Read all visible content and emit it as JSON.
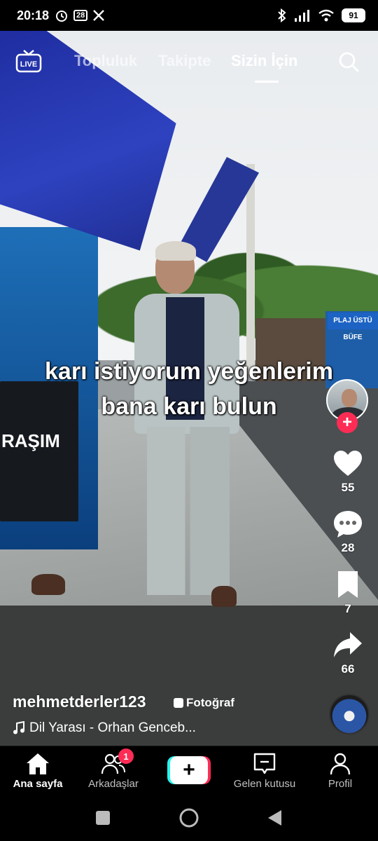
{
  "status_bar": {
    "time": "20:18",
    "calendar_day": "28",
    "battery": "91"
  },
  "top_nav": {
    "live_label": "LIVE",
    "tabs": [
      {
        "label": "Topluluk"
      },
      {
        "label": "Takipte"
      },
      {
        "label": "Sizin İçin"
      }
    ]
  },
  "video": {
    "caption_line1": "karı istiyorum yeğenlerim",
    "caption_line2": "bana karı bulun",
    "freezer_text": "RAŞIM",
    "kiosk_sign": "PLAJ ÜSTÜ BÜFE"
  },
  "rail": {
    "follow_label": "+",
    "likes": "55",
    "comments": "28",
    "saves": "7",
    "shares": "66"
  },
  "post": {
    "username": "mehmetderler123",
    "badge": "Fotoğraf",
    "music": "Dil Yarası - Orhan Genceb..."
  },
  "bottom_nav": {
    "items": [
      {
        "label": "Ana sayfa"
      },
      {
        "label": "Arkadaşlar"
      },
      {
        "label": "+"
      },
      {
        "label": "Gelen kutusu"
      },
      {
        "label": "Profil"
      }
    ],
    "friends_badge": "1"
  },
  "colors": {
    "accent_red": "#fe2c55",
    "accent_cyan": "#25f4ee"
  }
}
